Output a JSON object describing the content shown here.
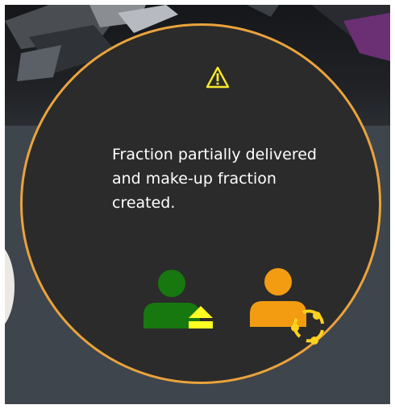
{
  "dialog": {
    "message": " Fraction partially delivered\nand make-up fraction\ncreated.",
    "border_color": "#eaa33c",
    "background_color": "#2b2b2b",
    "text_color": "#ffffff"
  },
  "icons": {
    "warning": {
      "name": "warning-triangle-icon",
      "color": "#f5ea2a"
    },
    "partially_delivered": {
      "name": "patient-eject-icon",
      "person_color": "#16780f",
      "badge_color": "#ffff22"
    },
    "makeup_fraction": {
      "name": "patient-cycle-icon",
      "person_color": "#f39c12",
      "badge_color": "#ffd21c"
    }
  }
}
